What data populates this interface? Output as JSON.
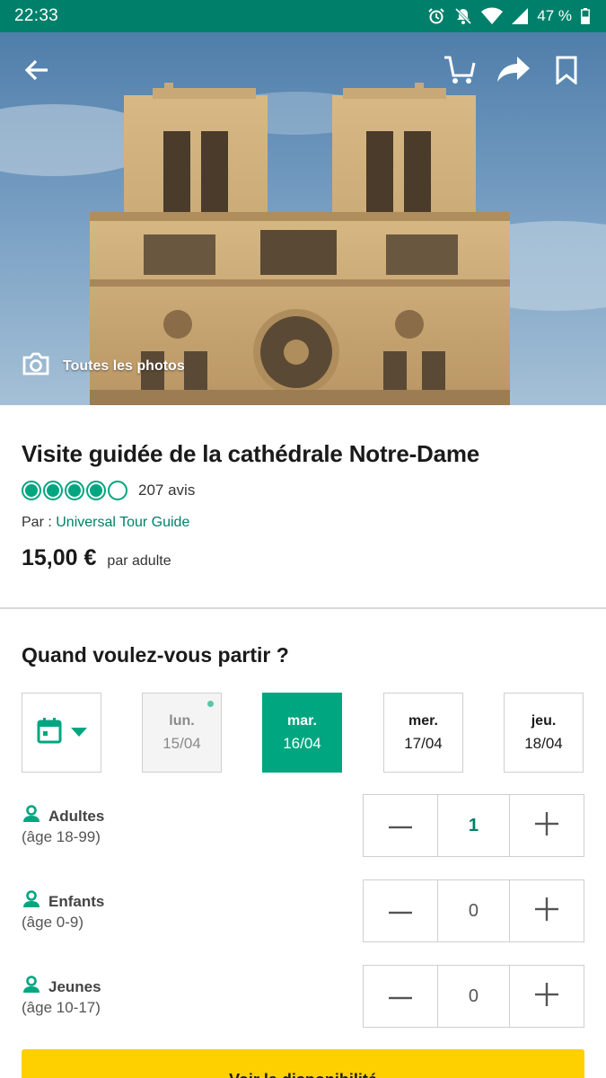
{
  "status_bar": {
    "time": "22:33",
    "battery": "47 %"
  },
  "hero": {
    "photos_label": "Toutes les photos"
  },
  "listing": {
    "title": "Visite guidée de la cathédrale Notre-Dame",
    "rating_bubbles": 4,
    "rating_max": 5,
    "review_count": "207 avis",
    "by_prefix": "Par : ",
    "operator": "Universal Tour Guide",
    "price": "15,00 €",
    "price_unit": "par adulte"
  },
  "booking": {
    "title": "Quand voulez-vous partir ?",
    "dates": [
      {
        "dow": "lun.",
        "dom": "15/04",
        "state": "disabled"
      },
      {
        "dow": "mar.",
        "dom": "16/04",
        "state": "selected"
      },
      {
        "dow": "mer.",
        "dom": "17/04",
        "state": "normal"
      },
      {
        "dow": "jeu.",
        "dom": "18/04",
        "state": "normal"
      }
    ],
    "guests": [
      {
        "label": "Adultes",
        "age": "(âge 18-99)",
        "value": "1"
      },
      {
        "label": "Enfants",
        "age": "(âge 0-9)",
        "value": "0"
      },
      {
        "label": "Jeunes",
        "age": "(âge 10-17)",
        "value": "0"
      }
    ],
    "cta_label": "Voir la disponibilité"
  },
  "colors": {
    "status_bar": "#00806a",
    "accent": "#00a680",
    "cta": "#ffd000"
  },
  "icons": [
    "back-arrow-icon",
    "cart-icon",
    "share-icon",
    "bookmark-icon",
    "camera-icon",
    "calendar-icon",
    "person-icon",
    "minus-icon",
    "plus-icon"
  ]
}
